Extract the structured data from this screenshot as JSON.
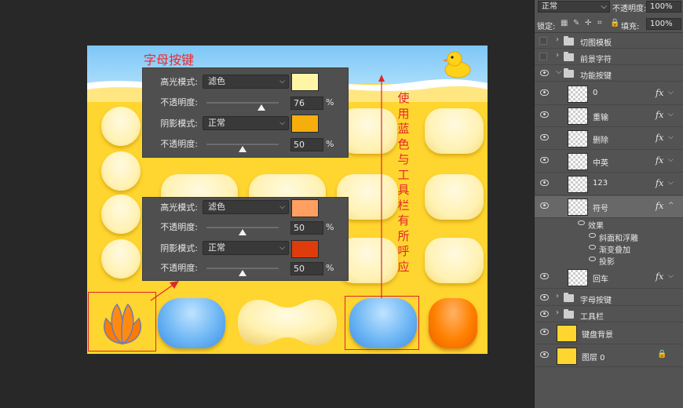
{
  "canvas": {
    "title": "字母按键",
    "annotation_vertical": [
      "使",
      "用",
      "蓝",
      "色",
      "与",
      "工",
      "具",
      "栏",
      "有",
      "所",
      "呼",
      "应"
    ]
  },
  "panel_top": {
    "highlight_mode_label": "高光模式:",
    "highlight_mode_value": "滤色",
    "highlight_color": "#fff5a6",
    "opacity_label": "不透明度:",
    "highlight_opacity": "76",
    "highlight_opacity_pct": 76,
    "shadow_mode_label": "阴影模式:",
    "shadow_mode_value": "正常",
    "shadow_color": "#f5ae0b",
    "shadow_opacity": "50",
    "shadow_opacity_pct": 50,
    "percent": "%"
  },
  "panel_bottom": {
    "highlight_mode_label": "高光模式:",
    "highlight_mode_value": "滤色",
    "highlight_color": "#ffa060",
    "opacity_label": "不透明度:",
    "highlight_opacity": "50",
    "highlight_opacity_pct": 50,
    "shadow_mode_label": "阴影模式:",
    "shadow_mode_value": "正常",
    "shadow_color": "#de3c0a",
    "shadow_opacity": "50",
    "shadow_opacity_pct": 50,
    "percent": "%"
  },
  "layers_panel": {
    "blend_mode": "正常",
    "opacity_label": "不透明度:",
    "opacity_value": "100%",
    "lock_label": "锁定:",
    "fill_label": "填充:",
    "fill_value": "100%",
    "layers": [
      {
        "name": "切图模板",
        "kind": "folder",
        "visible": false
      },
      {
        "name": "前景字符",
        "kind": "folder",
        "visible": false
      },
      {
        "name": "功能按键",
        "kind": "folder-open",
        "visible": true
      },
      {
        "name": "0",
        "kind": "smart",
        "fx": true
      },
      {
        "name": "重输",
        "kind": "smart",
        "fx": true
      },
      {
        "name": "删除",
        "kind": "smart",
        "fx": true
      },
      {
        "name": "中英",
        "kind": "smart",
        "fx": true
      },
      {
        "name": "123",
        "kind": "smart",
        "fx": true
      },
      {
        "name": "符号",
        "kind": "smart",
        "fx": true,
        "selected": true
      },
      {
        "name": "回车",
        "kind": "smart",
        "fx": true
      },
      {
        "name": "字母按键",
        "kind": "folder",
        "visible": true
      },
      {
        "name": "工具栏",
        "kind": "folder",
        "visible": true
      },
      {
        "name": "键盘背景",
        "kind": "fill",
        "visible": true
      },
      {
        "name": "图层 0",
        "kind": "fill",
        "visible": true
      }
    ],
    "effects_label": "效果",
    "effects": [
      "斜面和浮雕",
      "渐变叠加",
      "投影"
    ],
    "fx_label": "fx"
  },
  "colors": {
    "canvas_bg": "#ffd52f",
    "annotation_red": "#e0262b",
    "blue_key": "#5aa9f0",
    "orange_key": "#ff7a00"
  }
}
